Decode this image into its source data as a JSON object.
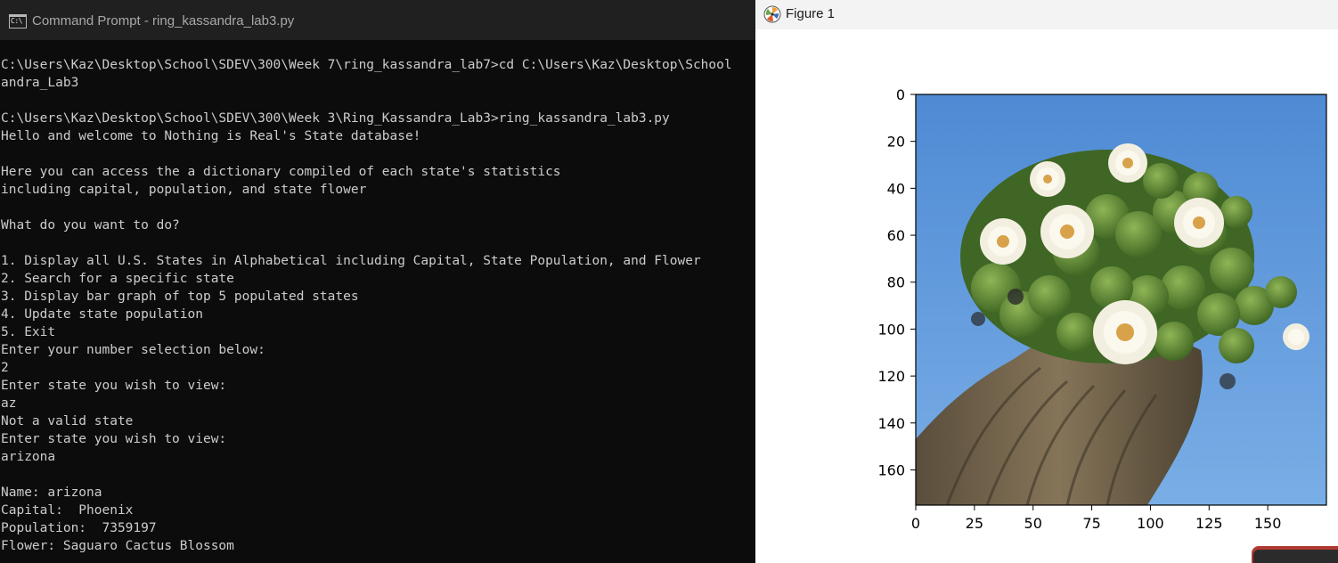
{
  "cmd": {
    "title": "Command Prompt - ring_kassandra_lab3.py",
    "icon_text": "C:\\",
    "lines": [
      "C:\\Users\\Kaz\\Desktop\\School\\SDEV\\300\\Week 7\\ring_kassandra_lab7>cd C:\\Users\\Kaz\\Desktop\\School",
      "andra_Lab3",
      "",
      "C:\\Users\\Kaz\\Desktop\\School\\SDEV\\300\\Week 3\\Ring_Kassandra_Lab3>ring_kassandra_lab3.py",
      "Hello and welcome to Nothing is Real's State database!",
      "",
      "Here you can access the a dictionary compiled of each state's statistics",
      "including capital, population, and state flower",
      "",
      "What do you want to do?",
      "",
      "1. Display all U.S. States in Alphabetical including Capital, State Population, and Flower",
      "2. Search for a specific state",
      "3. Display bar graph of top 5 populated states",
      "4. Update state population",
      "5. Exit",
      "Enter your number selection below:",
      "2",
      "Enter state you wish to view:",
      "az",
      "Not a valid state",
      "Enter state you wish to view:",
      "arizona",
      "",
      "Name: arizona",
      "Capital:  Phoenix",
      "Population:  7359197",
      "Flower: Saguaro Cactus Blossom"
    ]
  },
  "figure": {
    "title": "Figure 1",
    "icon": "matplotlib-logo-icon",
    "image_subject": "saguaro-cactus-blossom",
    "colors": {
      "sky": "#5a93d6",
      "cactus_body": "#6b5e48",
      "bud_green": "#4f7a2c",
      "petal": "#f7f3e6",
      "flower_center": "#d7a24a"
    }
  },
  "chart_data": {
    "type": "image",
    "xlim": [
      0,
      175
    ],
    "ylim": [
      175,
      0
    ],
    "x_ticks": [
      "0",
      "25",
      "50",
      "75",
      "100",
      "125",
      "150"
    ],
    "y_ticks": [
      "0",
      "20",
      "40",
      "60",
      "80",
      "100",
      "120",
      "140",
      "160"
    ]
  }
}
